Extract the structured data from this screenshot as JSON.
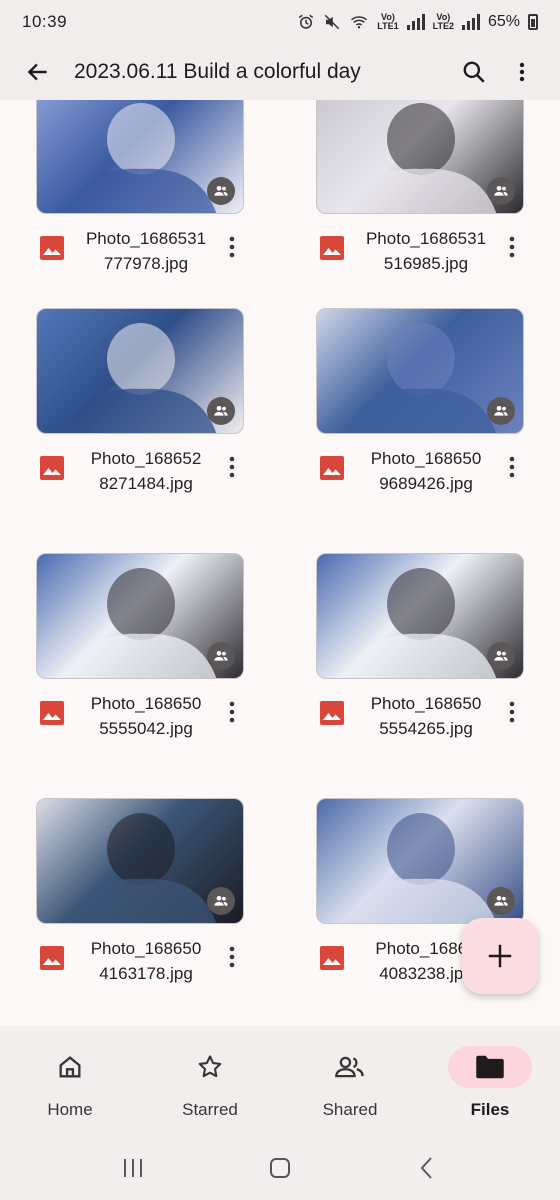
{
  "status_bar": {
    "time": "10:39",
    "lte1": "Vo)\nLTE1",
    "lte2": "Vo)\nLTE2",
    "battery_text": "65%"
  },
  "app_bar": {
    "title": "2023.06.11 Build a colorful day",
    "back_icon": "arrow-back-icon",
    "search_icon": "search-icon",
    "more_icon": "more-vert-icon"
  },
  "files": [
    {
      "name_line1": "Photo_1686531",
      "name_line2": "777978.jpg",
      "thumb_colors": [
        "#3b5aa0",
        "#8aa0d8",
        "#f0eef5"
      ]
    },
    {
      "name_line1": "Photo_1686531",
      "name_line2": "516985.jpg",
      "thumb_colors": [
        "#e8e6ec",
        "#c9c6d0",
        "#2b2a2e"
      ]
    },
    {
      "name_line1": "Photo_168652",
      "name_line2": "8271484.jpg",
      "thumb_colors": [
        "#2f4f8a",
        "#5577b8",
        "#f2eef0"
      ]
    },
    {
      "name_line1": "Photo_168650",
      "name_line2": "9689426.jpg",
      "thumb_colors": [
        "#3d5f9c",
        "#d0d5ea",
        "#6c82be"
      ]
    },
    {
      "name_line1": "Photo_168650",
      "name_line2": "5555042.jpg",
      "thumb_colors": [
        "#eef0f6",
        "#4a6ab0",
        "#2c2c32"
      ]
    },
    {
      "name_line1": "Photo_168650",
      "name_line2": "5554265.jpg",
      "thumb_colors": [
        "#eef0f6",
        "#4a6ab0",
        "#2c2c32"
      ]
    },
    {
      "name_line1": "Photo_168650",
      "name_line2": "4163178.jpg",
      "thumb_colors": [
        "#3c5678",
        "#dcdde6",
        "#1c1c22"
      ]
    },
    {
      "name_line1": "Photo_16865",
      "name_line2": "4083238.jpg",
      "thumb_colors": [
        "#d9dfee",
        "#4d6ba8",
        "#3b4f86"
      ]
    }
  ],
  "fab": {
    "icon": "add-icon"
  },
  "bottom_nav": {
    "items": [
      {
        "label": "Home",
        "icon": "home-icon",
        "active": false
      },
      {
        "label": "Starred",
        "icon": "star-icon",
        "active": false
      },
      {
        "label": "Shared",
        "icon": "people-icon",
        "active": false
      },
      {
        "label": "Files",
        "icon": "folder-icon",
        "active": true
      }
    ]
  },
  "colors": {
    "accent_pill": "#fcd6dc",
    "fab": "#fcdde2",
    "image_file_icon": "#d9473a"
  }
}
